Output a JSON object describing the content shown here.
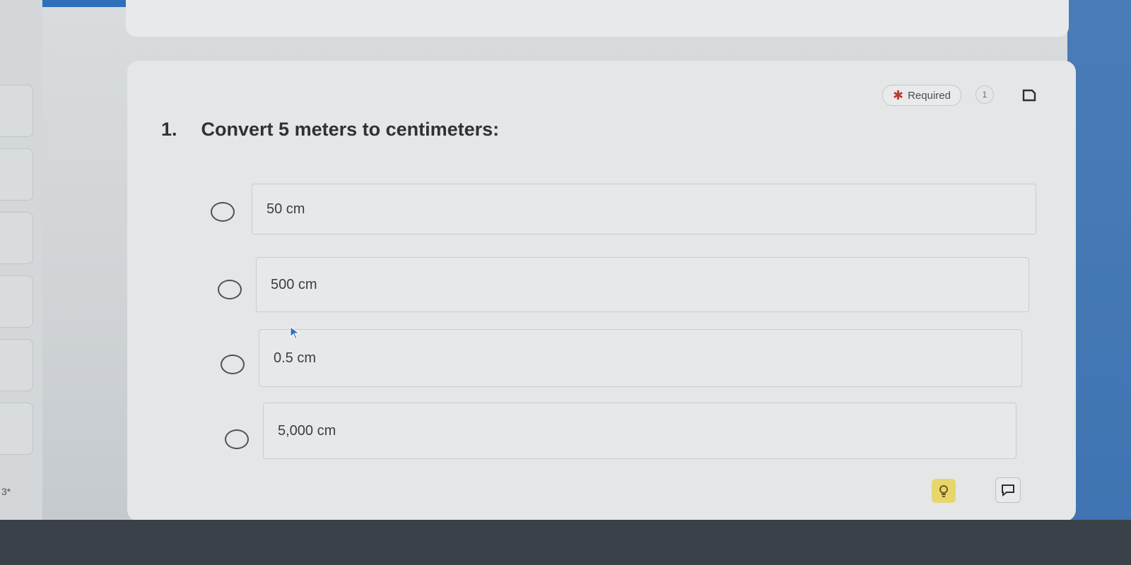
{
  "header": {
    "required_label": "Required",
    "required_marker": "✱",
    "question_count": "1"
  },
  "question": {
    "number": "1.",
    "text": "Convert 5 meters to centimeters:"
  },
  "options": [
    {
      "label": "50 cm"
    },
    {
      "label": "500 cm"
    },
    {
      "label": "0.5 cm"
    },
    {
      "label": "5,000 cm"
    }
  ],
  "sidebar": {
    "next_marker": "3*"
  },
  "icons": {
    "bookmark": "bookmark-icon",
    "hint": "lightbulb-icon",
    "comment": "comment-icon"
  },
  "colors": {
    "accent_blue": "#2f6fb8",
    "required_star": "#c0392b",
    "hint_button": "#e7d66a"
  }
}
